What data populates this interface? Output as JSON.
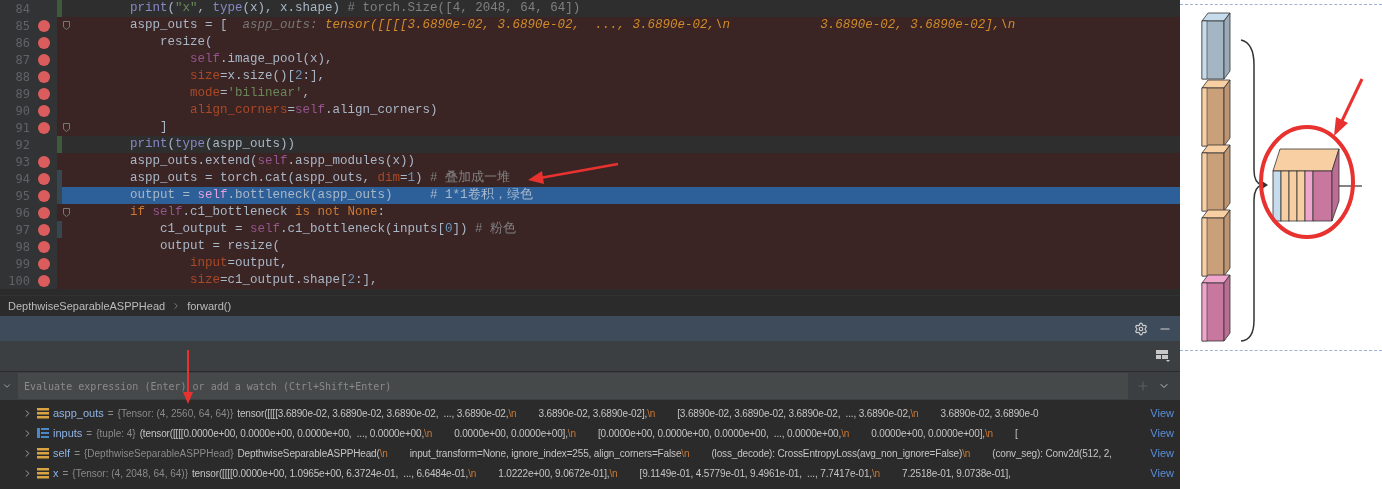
{
  "editor": {
    "lines": [
      {
        "number": "84",
        "breakpoint": false,
        "current": false,
        "fold": false,
        "color": "#3f5a3a",
        "segments": [
          {
            "kind": "builtin",
            "text": "print"
          },
          {
            "kind": "plain",
            "text": "("
          },
          {
            "kind": "string",
            "text": "\"x\""
          },
          {
            "kind": "plain",
            "text": ", "
          },
          {
            "kind": "builtin",
            "text": "type"
          },
          {
            "kind": "plain",
            "text": "(x), x.shape) "
          },
          {
            "kind": "comment",
            "text": "# torch.Size([4, 2048, 64, 64])"
          }
        ]
      },
      {
        "number": "85",
        "breakpoint": true,
        "current": false,
        "fold": true,
        "segments": [
          {
            "kind": "plain",
            "text": "aspp_outs = [  "
          },
          {
            "kind": "hint-name",
            "text": "aspp_outs: "
          },
          {
            "kind": "hint-value",
            "text": "tensor([[[[3.6890e-02, 3.6890e-02,  ..., 3.6890e-02,\\n            3.6890e-02, 3.6890e-02],\\n"
          }
        ],
        "children": [
          {
            "number": "86",
            "breakpoint": true,
            "current": false,
            "fold": false,
            "segments": [
              {
                "kind": "plain",
                "text": "resize("
              }
            ],
            "children": [
              {
                "number": "87",
                "breakpoint": true,
                "current": false,
                "fold": false,
                "segments": [
                  {
                    "kind": "self",
                    "text": "self"
                  },
                  {
                    "kind": "plain",
                    "text": ".image_pool(x),"
                  }
                ]
              },
              {
                "number": "88",
                "breakpoint": true,
                "current": false,
                "fold": false,
                "segments": [
                  {
                    "kind": "param",
                    "text": "size"
                  },
                  {
                    "kind": "plain",
                    "text": "=x.size()["
                  },
                  {
                    "kind": "number",
                    "text": "2"
                  },
                  {
                    "kind": "plain",
                    "text": ":],"
                  }
                ]
              },
              {
                "number": "89",
                "breakpoint": true,
                "current": false,
                "fold": false,
                "segments": [
                  {
                    "kind": "param",
                    "text": "mode"
                  },
                  {
                    "kind": "plain",
                    "text": "="
                  },
                  {
                    "kind": "string",
                    "text": "'bilinear'"
                  },
                  {
                    "kind": "plain",
                    "text": ","
                  }
                ]
              },
              {
                "number": "90",
                "breakpoint": true,
                "current": false,
                "fold": false,
                "segments": [
                  {
                    "kind": "param",
                    "text": "align_corners"
                  },
                  {
                    "kind": "plain",
                    "text": "="
                  },
                  {
                    "kind": "self",
                    "text": "self"
                  },
                  {
                    "kind": "plain",
                    "text": ".align_corners)"
                  }
                ]
              }
            ]
          },
          {
            "number": "91",
            "breakpoint": true,
            "current": false,
            "fold": true,
            "segments": [
              {
                "kind": "plain",
                "text": "]"
              }
            ]
          }
        ]
      },
      {
        "number": "92",
        "breakpoint": false,
        "current": false,
        "fold": false,
        "color": "#3f5a3a",
        "segments": [
          {
            "kind": "builtin",
            "text": "print"
          },
          {
            "kind": "plain",
            "text": "("
          },
          {
            "kind": "builtin",
            "text": "type"
          },
          {
            "kind": "plain",
            "text": "(aspp_outs))"
          }
        ]
      },
      {
        "number": "93",
        "breakpoint": true,
        "current": false,
        "fold": false,
        "segments": [
          {
            "kind": "plain",
            "text": "aspp_outs.extend("
          },
          {
            "kind": "self",
            "text": "self"
          },
          {
            "kind": "plain",
            "text": ".aspp_modules(x))"
          }
        ]
      },
      {
        "number": "94",
        "breakpoint": true,
        "current": false,
        "fold": false,
        "color": "#374752",
        "segments": [
          {
            "kind": "plain",
            "text": "aspp_outs = torch.cat(aspp_outs, "
          },
          {
            "kind": "param",
            "text": "dim"
          },
          {
            "kind": "plain",
            "text": "="
          },
          {
            "kind": "number",
            "text": "1"
          },
          {
            "kind": "plain",
            "text": ") "
          },
          {
            "kind": "comment",
            "text": "# 叠加成一堆"
          }
        ]
      },
      {
        "number": "95",
        "breakpoint": true,
        "current": true,
        "fold": false,
        "color": "#374752",
        "segments": [
          {
            "kind": "plain",
            "text": "output = "
          },
          {
            "kind": "self",
            "text": "self"
          },
          {
            "kind": "plain",
            "text": ".bottleneck(aspp_outs)     "
          },
          {
            "kind": "comment",
            "text": "# 1*1卷积，绿色"
          }
        ]
      },
      {
        "number": "96",
        "breakpoint": true,
        "current": false,
        "fold": true,
        "segments": [
          {
            "kind": "keyword",
            "text": "if "
          },
          {
            "kind": "self",
            "text": "self"
          },
          {
            "kind": "plain",
            "text": ".c1_bottleneck "
          },
          {
            "kind": "keyword",
            "text": "is not None"
          },
          {
            "kind": "plain",
            "text": ":"
          }
        ],
        "children": [
          {
            "number": "97",
            "breakpoint": true,
            "current": false,
            "fold": false,
            "color": "#374752",
            "segments": [
              {
                "kind": "plain",
                "text": "c1_output = "
              },
              {
                "kind": "self",
                "text": "self"
              },
              {
                "kind": "plain",
                "text": ".c1_bottleneck(inputs["
              },
              {
                "kind": "number",
                "text": "0"
              },
              {
                "kind": "plain",
                "text": "]) "
              },
              {
                "kind": "comment",
                "text": "# 粉色"
              }
            ]
          },
          {
            "number": "98",
            "breakpoint": true,
            "current": false,
            "fold": false,
            "segments": [
              {
                "kind": "plain",
                "text": "output = resize("
              }
            ],
            "children": [
              {
                "number": "99",
                "breakpoint": true,
                "current": false,
                "fold": false,
                "segments": [
                  {
                    "kind": "param",
                    "text": "input"
                  },
                  {
                    "kind": "plain",
                    "text": "=output,"
                  }
                ]
              },
              {
                "number": "100",
                "breakpoint": true,
                "current": false,
                "fold": false,
                "segments": [
                  {
                    "kind": "param",
                    "text": "size"
                  },
                  {
                    "kind": "plain",
                    "text": "=c1_output.shape["
                  },
                  {
                    "kind": "number",
                    "text": "2"
                  },
                  {
                    "kind": "plain",
                    "text": ":],"
                  }
                ]
              }
            ]
          }
        ]
      }
    ]
  },
  "breadcrumbs": [
    "DepthwiseSeparableASPPHead",
    "forward()"
  ],
  "watch": {
    "placeholder": "Evaluate expression (Enter) or add a watch (Ctrl+Shift+Enter)"
  },
  "variables": [
    {
      "kind": "tensor",
      "name": "aspp_outs",
      "equals": "=",
      "type": "{Tensor: (4, 2560, 64, 64)}",
      "link": "View",
      "value": [
        {
          "kind": "plain",
          "text": "tensor([[[[3.6890e-02, 3.6890e-02, 3.6890e-02,  ..., 3.6890e-02,"
        },
        {
          "kind": "escape",
          "text": "\\n"
        },
        {
          "kind": "plain",
          "text": "3.6890e-02, 3.6890e-02],"
        },
        {
          "kind": "escape",
          "text": "\\n"
        },
        {
          "kind": "plain",
          "text": "[3.6890e-02, 3.6890e-02, 3.6890e-02,  ..., 3.6890e-02,"
        },
        {
          "kind": "escape",
          "text": "\\n"
        },
        {
          "kind": "plain",
          "text": "3.6890e-02, 3.6890e-0"
        }
      ]
    },
    {
      "kind": "tuple",
      "name": "inputs",
      "equals": "=",
      "type": "{tuple: 4}",
      "link": "View",
      "value": [
        {
          "kind": "plain",
          "text": "(tensor([[[[0.0000e+00, 0.0000e+00, 0.0000e+00,  ..., 0.0000e+00,"
        },
        {
          "kind": "escape",
          "text": "\\n"
        },
        {
          "kind": "plain",
          "text": "0.0000e+00, 0.0000e+00],"
        },
        {
          "kind": "escape",
          "text": "\\n"
        },
        {
          "kind": "plain",
          "text": "[0.0000e+00, 0.0000e+00, 0.0000e+00,  ..., 0.0000e+00,"
        },
        {
          "kind": "escape",
          "text": "\\n"
        },
        {
          "kind": "plain",
          "text": "0.0000e+00, 0.0000e+00],"
        },
        {
          "kind": "escape",
          "text": "\\n"
        },
        {
          "kind": "plain",
          "text": "["
        }
      ]
    },
    {
      "kind": "object",
      "name": "self",
      "equals": "=",
      "type": "{DepthwiseSeparableASPPHead}",
      "link": "View",
      "value": [
        {
          "kind": "plain",
          "text": "DepthwiseSeparableASPPHead("
        },
        {
          "kind": "escape",
          "text": "\\n"
        },
        {
          "kind": "plain",
          "text": "input_transform=None, ignore_index=255, align_corners=False"
        },
        {
          "kind": "escape",
          "text": "\\n"
        },
        {
          "kind": "plain",
          "text": "(loss_decode): CrossEntropyLoss(avg_non_ignore=False)"
        },
        {
          "kind": "escape",
          "text": "\\n"
        },
        {
          "kind": "plain",
          "text": "(conv_seg): Conv2d(512, 2,"
        }
      ]
    },
    {
      "kind": "tensor",
      "name": "x",
      "equals": "=",
      "type": "{Tensor: (4, 2048, 64, 64)}",
      "link": "View",
      "value": [
        {
          "kind": "plain",
          "text": "tensor([[[[0.0000e+00, 1.0965e+00, 6.3724e-01,  ..., 6.6484e-01,"
        },
        {
          "kind": "escape",
          "text": "\\n"
        },
        {
          "kind": "plain",
          "text": "1.0222e+00, 9.0672e-01],"
        },
        {
          "kind": "escape",
          "text": "\\n"
        },
        {
          "kind": "plain",
          "text": "[9.1149e-01, 4.5779e-01, 9.4961e-01,  ..., 7.7417e-01,"
        },
        {
          "kind": "escape",
          "text": "\\n"
        },
        {
          "kind": "plain",
          "text": "7.2518e-01, 9.0738e-01],"
        }
      ]
    }
  ]
}
